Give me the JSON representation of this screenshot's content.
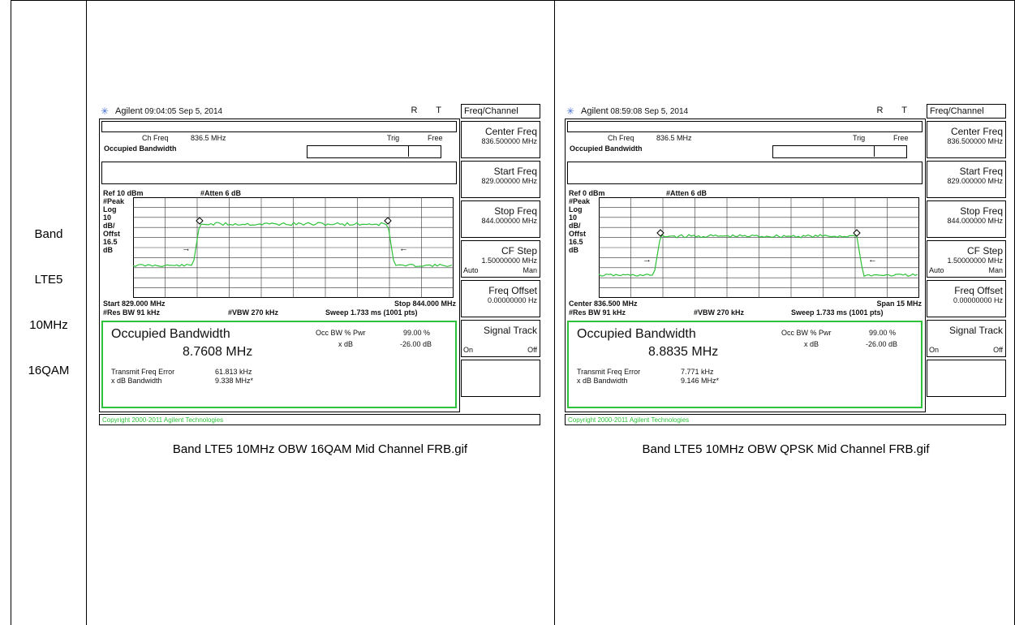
{
  "row_labels": [
    "Band",
    "LTE5",
    "10MHz",
    "16QAM"
  ],
  "panels": [
    {
      "brand": "Agilent",
      "timestamp": "09:04:05  Sep 5, 2014",
      "rt": "R  T",
      "menu_title": "Freq/Channel",
      "menu": [
        {
          "key": "Center Freq",
          "val": "836.500000 MHz"
        },
        {
          "key": "Start Freq",
          "val": "829.000000 MHz"
        },
        {
          "key": "Stop Freq",
          "val": "844.000000 MHz"
        },
        {
          "key": "CF Step",
          "val": "1.50000000 MHz",
          "left": "Auto",
          "right": "Man"
        },
        {
          "key": "Freq Offset",
          "val": "0.00000000  Hz"
        },
        {
          "key": "Signal Track",
          "val": "",
          "left": "On",
          "right": "Off"
        }
      ],
      "ch_freq_label": "Ch Freq",
      "ch_freq": "836.5 MHz",
      "trig_label": "Trig",
      "trig": "Free",
      "occ_header": "Occupied Bandwidth",
      "ref": "Ref  10 dBm",
      "atten": "#Atten 6 dB",
      "ylabels": "#Peak\nLog\n10\ndB/\nOffst\n16.5\ndB",
      "x_left": "Start 829.000 MHz",
      "x_right": "Stop 844.000 MHz",
      "rbw": "#Res BW 91 kHz",
      "vbw": "#VBW 270 kHz",
      "sweep": "Sweep 1.733 ms (1001 pts)",
      "occ_title": "Occupied Bandwidth",
      "occ_value": "8.7608 MHz",
      "occ_pwr_label": "Occ BW % Pwr",
      "occ_pwr": "99.00 %",
      "xdb_label": "x dB",
      "xdb": "-26.00 dB",
      "tfe_label": "Transmit Freq Error",
      "tfe": "61.813 kHz",
      "xbw_label": "x dB Bandwidth",
      "xbw": "9.338 MHz*",
      "copyright": "Copyright 2000-2011 Agilent Technologies",
      "caption": "Band LTE5 10MHz OBW 16QAM Mid Channel FRB.gif"
    },
    {
      "brand": "Agilent",
      "timestamp": "08:59:08  Sep 5, 2014",
      "rt": "R  T",
      "menu_title": "Freq/Channel",
      "menu": [
        {
          "key": "Center Freq",
          "val": "836.500000 MHz"
        },
        {
          "key": "Start Freq",
          "val": "829.000000 MHz"
        },
        {
          "key": "Stop Freq",
          "val": "844.000000 MHz"
        },
        {
          "key": "CF Step",
          "val": "1.50000000 MHz",
          "left": "Auto",
          "right": "Man"
        },
        {
          "key": "Freq Offset",
          "val": "0.00000000  Hz"
        },
        {
          "key": "Signal Track",
          "val": "",
          "left": "On",
          "right": "Off"
        }
      ],
      "ch_freq_label": "Ch Freq",
      "ch_freq": "836.5 MHz",
      "trig_label": "Trig",
      "trig": "Free",
      "occ_header": "Occupied Bandwidth",
      "ref": "Ref 0 dBm",
      "atten": "#Atten 6 dB",
      "ylabels": "#Peak\nLog\n10\ndB/\nOffst\n16.5\ndB",
      "x_left": "Center 836.500 MHz",
      "x_right": "Span 15 MHz",
      "rbw": "#Res BW 91 kHz",
      "vbw": "#VBW 270 kHz",
      "sweep": "Sweep 1.733 ms (1001 pts)",
      "occ_title": "Occupied Bandwidth",
      "occ_value": "8.8835 MHz",
      "occ_pwr_label": "Occ BW % Pwr",
      "occ_pwr": "99.00 %",
      "xdb_label": "x dB",
      "xdb": "-26.00 dB",
      "tfe_label": "Transmit Freq Error",
      "tfe": "7.771 kHz",
      "xbw_label": "x dB Bandwidth",
      "xbw": "9.146 MHz*",
      "copyright": "Copyright 2000-2011 Agilent Technologies",
      "caption": "Band LTE5 10MHz OBW QPSK Mid Channel FRB.gif"
    }
  ],
  "colors": {
    "trace": "#2ec13a",
    "grid": "#333333",
    "logo": "#4a6fd0"
  }
}
